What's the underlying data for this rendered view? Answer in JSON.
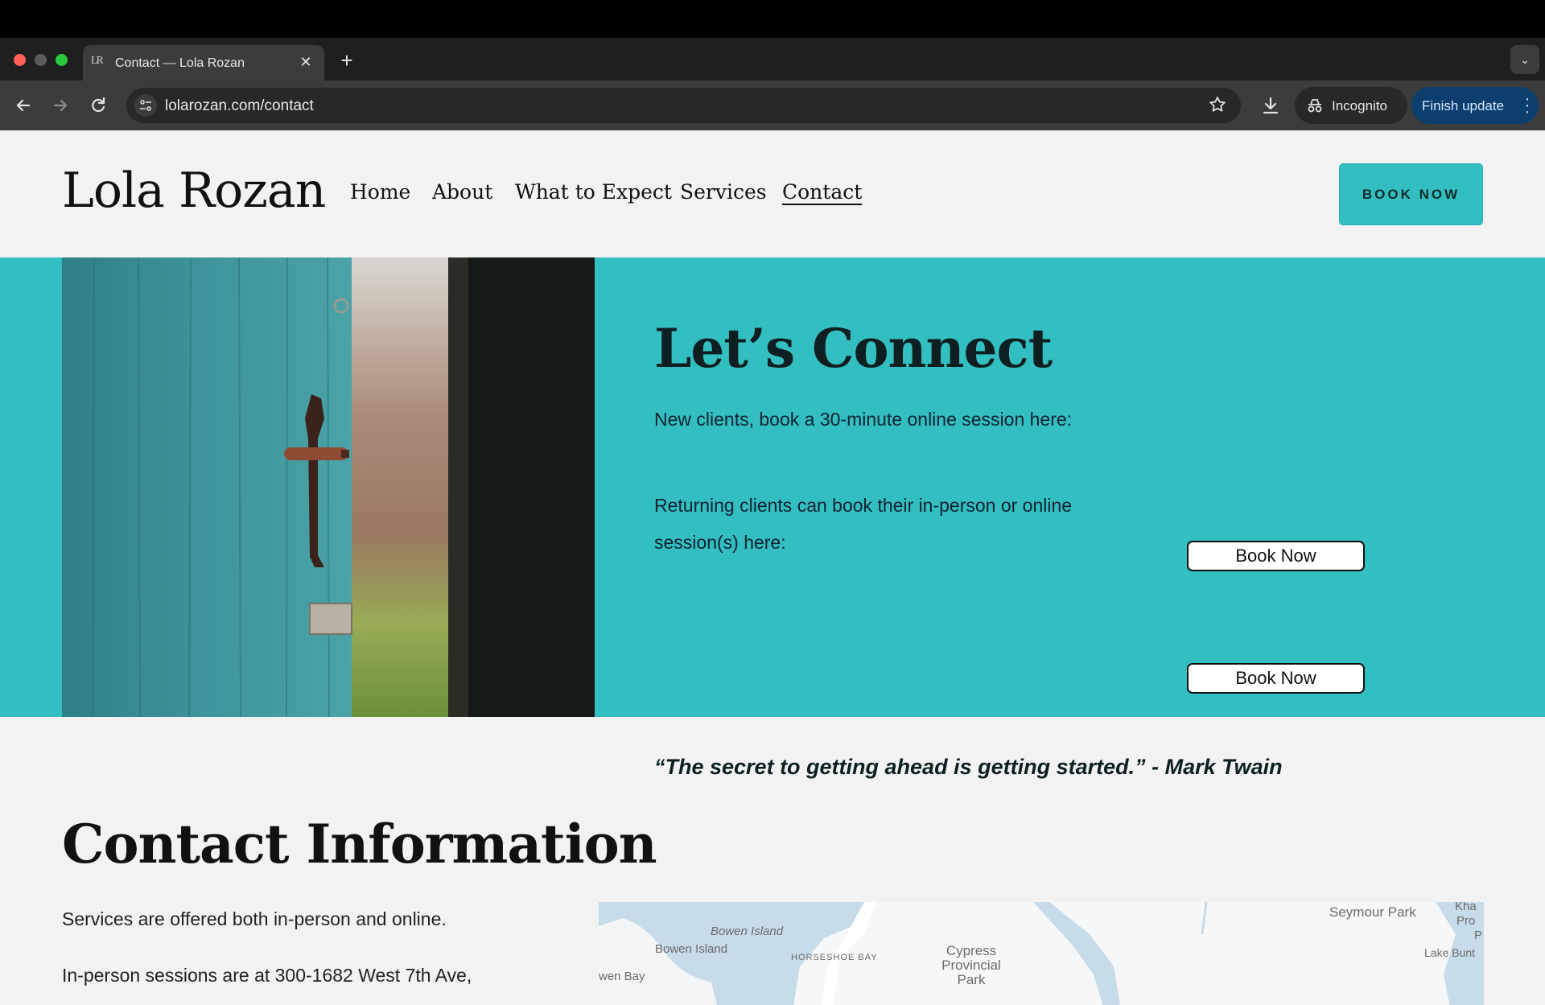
{
  "browser": {
    "tab_title": "Contact — Lola Rozan",
    "favicon_text": "LR",
    "url": "lolarozan.com/contact",
    "incognito_label": "Incognito",
    "finish_update_label": "Finish update"
  },
  "site": {
    "brand": "Lola Rozan",
    "nav": [
      {
        "label": "Home"
      },
      {
        "label": "About"
      },
      {
        "label": "What to Expect"
      },
      {
        "label": "Services"
      },
      {
        "label": "Contact"
      }
    ],
    "header_button": "BOOK NOW"
  },
  "hero": {
    "title": "Let’s Connect",
    "new_clients_text": "New  clients, book a 30-minute online session here:",
    "returning_text": "Returning clients can book their in-person or online session(s) here:",
    "book_button_1": "Book Now",
    "book_button_2": "Book Now",
    "quote": "“The secret to getting ahead is getting started.” - Mark Twain"
  },
  "contact": {
    "title": "Contact Information",
    "line1": "Services are offered both in-person and online.",
    "line2": "In-person sessions are at 300-1682 West 7th Ave,"
  },
  "map": {
    "labels": [
      "Bowen Island",
      "Bowen Island",
      "HORSESHOE BAY",
      "Cypress Provincial Park",
      "wen Bay",
      "Seymour Park",
      "Lake Bunt",
      "Kha",
      "Pro",
      "P"
    ]
  },
  "colors": {
    "accent": "#33bec1",
    "page_bg": "#f2f2f2"
  }
}
